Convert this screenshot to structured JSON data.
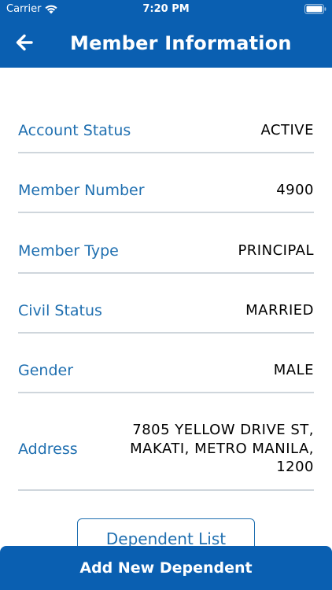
{
  "status_bar": {
    "carrier": "Carrier",
    "time": "7:20 PM",
    "icons": [
      "wifi-icon",
      "battery-icon"
    ]
  },
  "nav": {
    "title": "Member Information",
    "back_icon": "back-arrow-icon"
  },
  "member": {
    "rows": [
      {
        "label": "Account Status",
        "value": "ACTIVE"
      },
      {
        "label": "Member Number",
        "value": "4900"
      },
      {
        "label": "Member Type",
        "value": "PRINCIPAL"
      },
      {
        "label": "Civil Status",
        "value": "MARRIED"
      },
      {
        "label": "Gender",
        "value": "MALE"
      }
    ],
    "address": {
      "label": "Address",
      "lines": [
        "7805 YELLOW DRIVE ST,",
        "MAKATI, METRO MANILA,",
        "1200"
      ]
    }
  },
  "actions": {
    "dependent_list": "Dependent List",
    "add_dependent": "Add New Dependent"
  },
  "colors": {
    "primary": "#0a5fb1",
    "label": "#1f6fb0",
    "divider": "#cfd6dc"
  }
}
